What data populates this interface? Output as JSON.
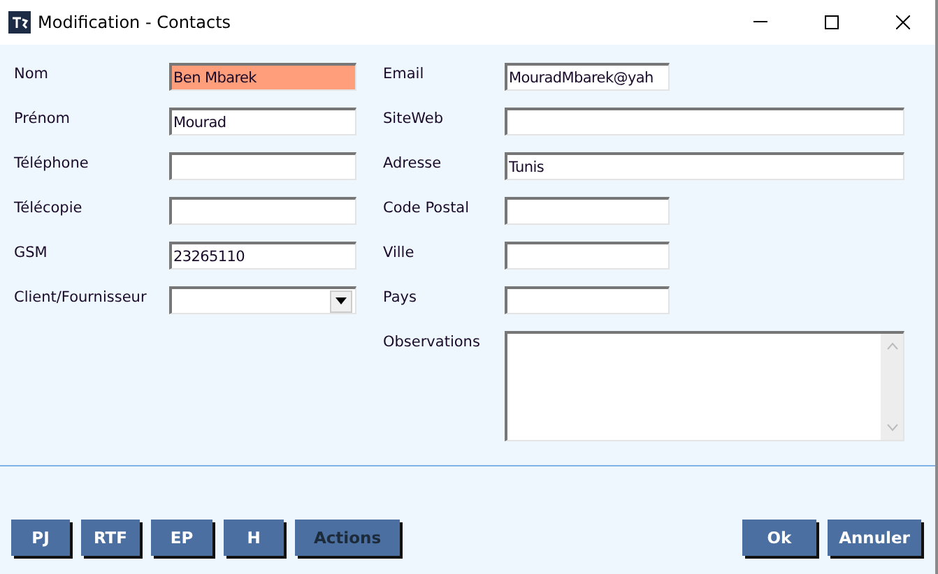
{
  "window": {
    "title": "Modification - Contacts"
  },
  "left_fields": [
    {
      "label": "Nom",
      "kind": "text",
      "value": "Ben Mbarek",
      "highlighted": true
    },
    {
      "label": "Prénom",
      "kind": "text",
      "value": "Mourad",
      "highlighted": false
    },
    {
      "label": "Téléphone",
      "kind": "text",
      "highlighted": false
    },
    {
      "label": "Télécopie",
      "kind": "text",
      "highlighted": false
    },
    {
      "label": "GSM",
      "kind": "text",
      "value": "23265110",
      "highlighted": false
    },
    {
      "label": "Client/Fournisseur",
      "kind": "dropdown",
      "highlighted": false
    }
  ],
  "right_fields": [
    {
      "label": "Email",
      "kind": "short",
      "value": "MouradMbarek@yah"
    },
    {
      "label": "SiteWeb",
      "kind": "long"
    },
    {
      "label": "Adresse",
      "kind": "long",
      "value": "Tunis"
    },
    {
      "label": "Code Postal",
      "kind": "short"
    },
    {
      "label": "Ville",
      "kind": "short"
    },
    {
      "label": "Pays",
      "kind": "short"
    },
    {
      "label": "Observations",
      "kind": "memo"
    }
  ],
  "left_buttons": [
    {
      "label": "PJ",
      "disabled": false
    },
    {
      "label": "RTF",
      "disabled": false
    },
    {
      "label": "EP",
      "disabled": false
    },
    {
      "label": "H",
      "disabled": false
    },
    {
      "label": "Actions",
      "disabled": true
    }
  ],
  "right_buttons": [
    {
      "label": "Ok",
      "disabled": false
    },
    {
      "label": "Annuler",
      "disabled": false
    }
  ]
}
